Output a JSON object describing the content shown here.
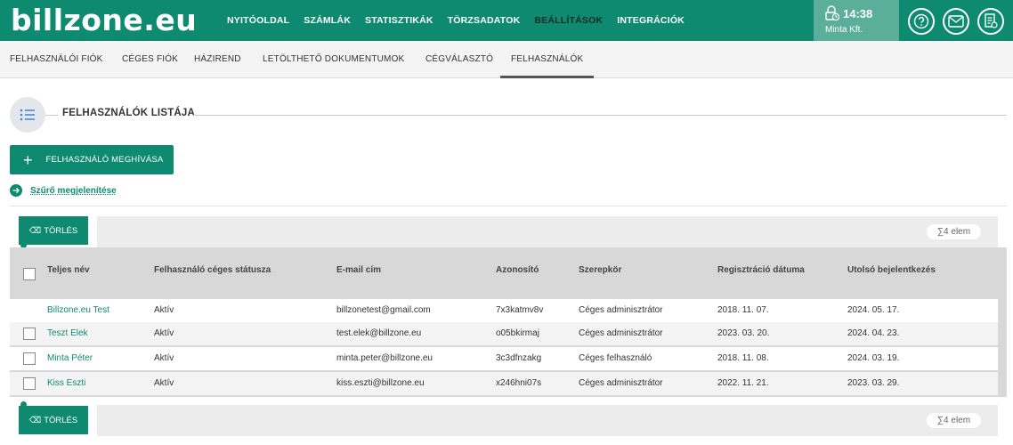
{
  "logo": "billzone.eu",
  "main_nav": [
    {
      "label": "NYITÓOLDAL",
      "active": false
    },
    {
      "label": "SZÁMLÁK",
      "active": false
    },
    {
      "label": "STATISZTIKÁK",
      "active": false
    },
    {
      "label": "TÖRZSADATOK",
      "active": false
    },
    {
      "label": "BEÁLLÍTÁSOK",
      "active": true
    },
    {
      "label": "INTEGRÁCIÓK",
      "active": false
    }
  ],
  "session": {
    "time": "14:38",
    "company": "Minta Kft.",
    "icon": "lock-clock-icon"
  },
  "header_icons": [
    "help-icon",
    "mail-icon",
    "invoice-icon"
  ],
  "sub_nav": [
    {
      "label": "FELHASZNÁLÓI FIÓK",
      "active": false
    },
    {
      "label": "CÉGES FIÓK",
      "active": false
    },
    {
      "label": "HÁZIREND",
      "active": false
    },
    {
      "label": "LETÖLTHETŐ DOKUMENTUMOK",
      "active": false
    },
    {
      "label": "CÉGVÁLASZTÓ",
      "active": false
    },
    {
      "label": "FELHASZNÁLÓK",
      "active": true
    }
  ],
  "section": {
    "title": "FELHASZNÁLÓK LISTÁJA",
    "icon": "list-icon"
  },
  "invite_button": {
    "plus": "+",
    "label": "FELHASZNÁLÓ MEGHÍVÁSA"
  },
  "filter_link": "Szűrő megjelenítése",
  "delete_button": {
    "label": "TÖRLÉS",
    "icon": "⌫"
  },
  "count_badge": "∑4 elem",
  "columns": [
    "Teljes név",
    "Felhasználó céges státusza",
    "E-mail cím",
    "Azonosító",
    "Szerepkör",
    "Regisztráció dátuma",
    "Utolsó bejelentkezés"
  ],
  "rows": [
    {
      "name": "Billzone.eu Test",
      "status": "Aktív",
      "email": "billzonetest@gmail.com",
      "id": "7x3katmv8v",
      "role": "Céges adminisztrátor",
      "registered": "2018. 11. 07.",
      "last_login": "2024. 05. 17.",
      "checkbox": false
    },
    {
      "name": "Teszt Elek",
      "status": "Aktív",
      "email": "test.elek@billzone.eu",
      "id": "o05bkirmaj",
      "role": "Céges adminisztrátor",
      "registered": "2023. 03. 20.",
      "last_login": "2024. 04. 23.",
      "checkbox": true
    },
    {
      "name": "Minta Péter",
      "status": "Aktív",
      "email": "minta.peter@billzone.eu",
      "id": "3c3dfnzakg",
      "role": "Céges felhasználó",
      "registered": "2018. 11. 08.",
      "last_login": "2024. 03. 19.",
      "checkbox": true
    },
    {
      "name": "Kiss Eszti",
      "status": "Aktív",
      "email": "kiss.eszti@billzone.eu",
      "id": "x246hni07s",
      "role": "Céges adminisztrátor",
      "registered": "2022. 11. 21.",
      "last_login": "2023. 03. 29.",
      "checkbox": true
    }
  ],
  "colors": {
    "brand": "#0e8a70",
    "session_bg": "#5aae9a",
    "table_bg": "#d8d8d8"
  }
}
